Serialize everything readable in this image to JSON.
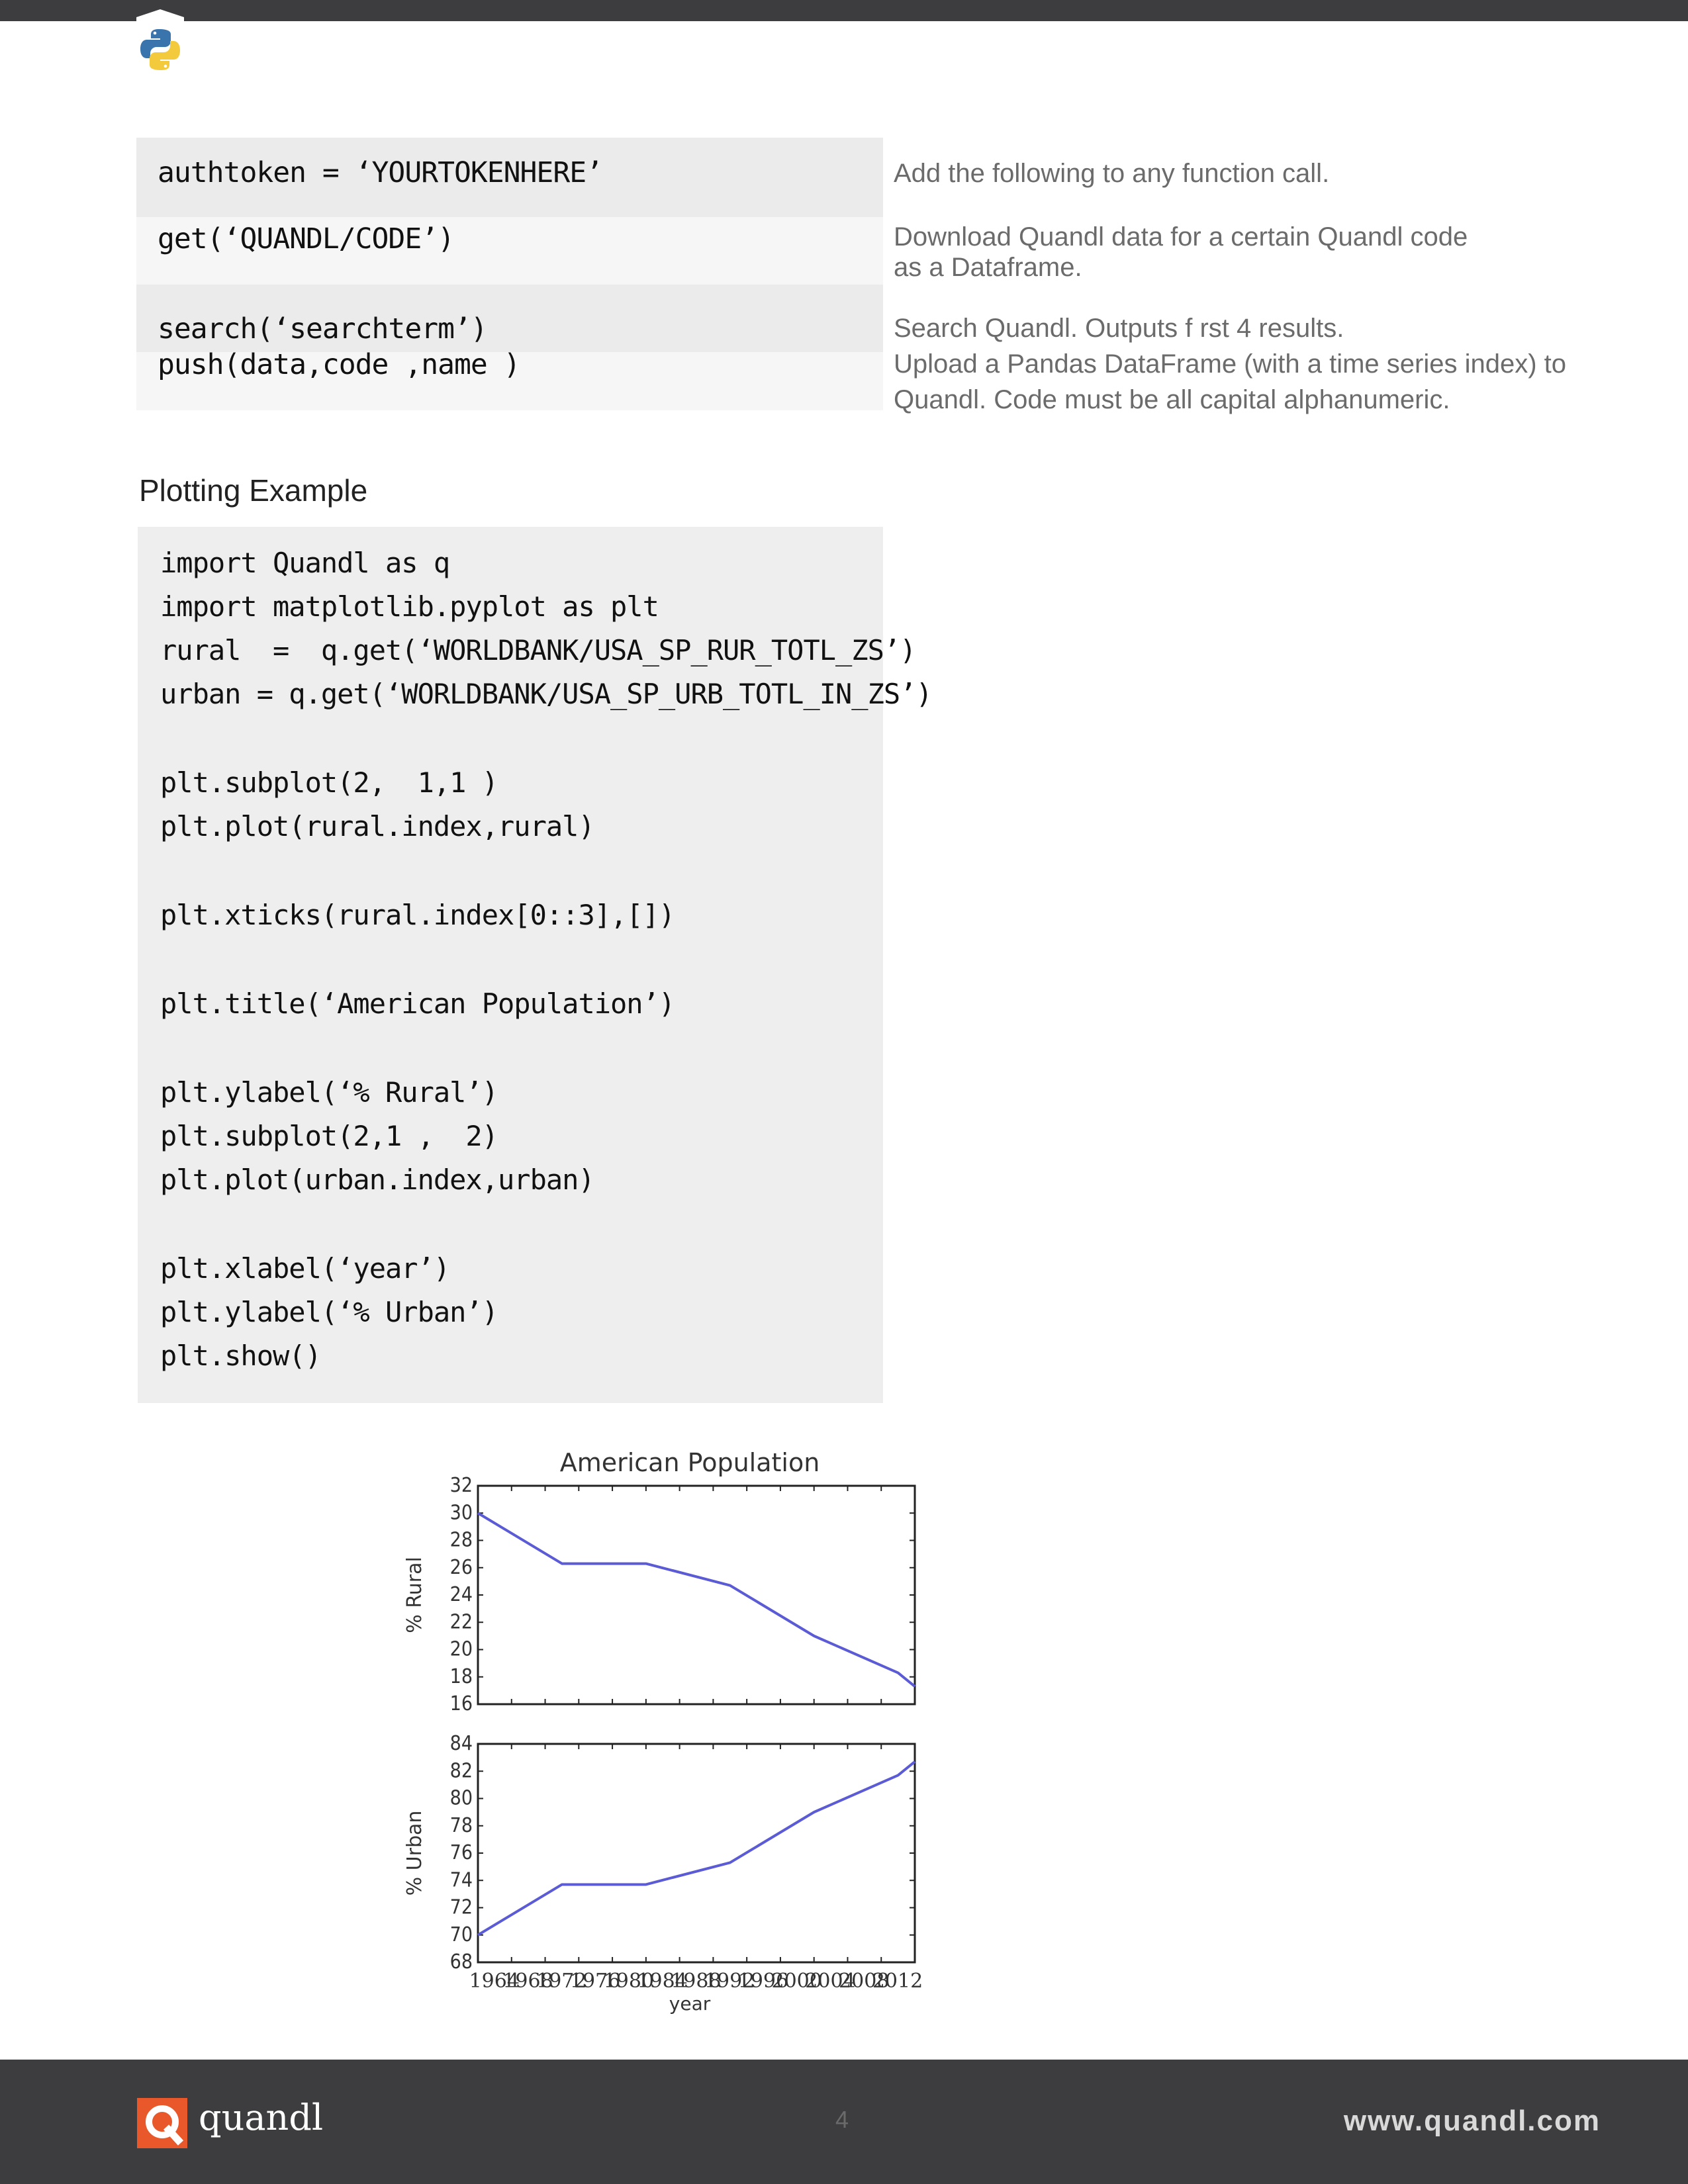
{
  "api_table": {
    "rows": [
      {
        "code": "authtoken = ‘YOURTOKENHERE’",
        "desc": "Add the following to any function call."
      },
      {
        "code": "get(‘QUANDL/CODE’)",
        "desc_lines": [
          "Download Quandl data for a certain Quandl code",
          "as  a Dataframe."
        ]
      },
      {
        "code": "search(‘searchterm’)",
        "desc": "Search Quandl. Outputs f rst 4 results."
      },
      {
        "code": "push(data,code ,name )",
        "desc_lines": [
          "Upload a Pandas DataFrame (with a time series index) to",
          "Quandl. Code must be all capital alphanumeric."
        ]
      }
    ]
  },
  "section_title": "Plotting Example",
  "code_lines": [
    "import Quandl as q",
    "import matplotlib.pyplot as plt",
    "rural  =  q.get(‘WORLDBANK/USA_SP_RUR_TOTL_ZS’)",
    "urban = q.get(‘WORLDBANK/USA_SP_URB_TOTL_IN_ZS’)",
    "",
    "plt.subplot(2,  1,1 )",
    "plt.plot(rural.index,rural)",
    "",
    "plt.xticks(rural.index[0::3],[])",
    "",
    "plt.title(‘American Population’)",
    "",
    "plt.ylabel(‘% Rural’)",
    "plt.subplot(2,1 ,  2)",
    "plt.plot(urban.index,urban)",
    "",
    "plt.xlabel(‘year’)",
    "plt.ylabel(‘% Urban’)",
    "plt.show()"
  ],
  "chart_data": [
    {
      "type": "line",
      "title": "American Population",
      "ylabel": "% Rural",
      "xlabel": "",
      "ylim": [
        16,
        32
      ],
      "yticks": [
        "32",
        "30",
        "28",
        "26",
        "24",
        "22",
        "20",
        "18",
        "16"
      ],
      "x": [
        1960,
        1970,
        1980,
        1990,
        2000,
        2010,
        2012
      ],
      "values": [
        30.0,
        26.3,
        26.3,
        24.7,
        21.0,
        18.3,
        17.3
      ],
      "color": "#5b5bd6",
      "grid": false
    },
    {
      "type": "line",
      "title": "",
      "ylabel": "% Urban",
      "xlabel": "year",
      "ylim": [
        68,
        84
      ],
      "yticks": [
        "84",
        "82",
        "80",
        "78",
        "76",
        "74",
        "72",
        "70",
        "68"
      ],
      "x": [
        1960,
        1970,
        1980,
        1990,
        2000,
        2010,
        2012
      ],
      "values": [
        70.0,
        73.7,
        73.7,
        75.3,
        79.0,
        81.7,
        82.7
      ],
      "xticks": [
        "1964",
        "1968",
        "1972",
        "1976",
        "1980",
        "1984",
        "1988",
        "1992",
        "1996",
        "2000",
        "2004",
        "2008",
        "2012"
      ],
      "color": "#5b5bd6",
      "grid": false
    }
  ],
  "footer": {
    "brand": "quandl",
    "page_number": "4",
    "website": "www.quandl.com"
  },
  "colors": {
    "dark_bar": "#3d3d3f",
    "brand_orange": "#e8582a",
    "code_bg": "#eeeeee",
    "line": "#5b5bd6"
  },
  "icons": [
    "python-logo-icon",
    "quandl-logo-icon"
  ]
}
